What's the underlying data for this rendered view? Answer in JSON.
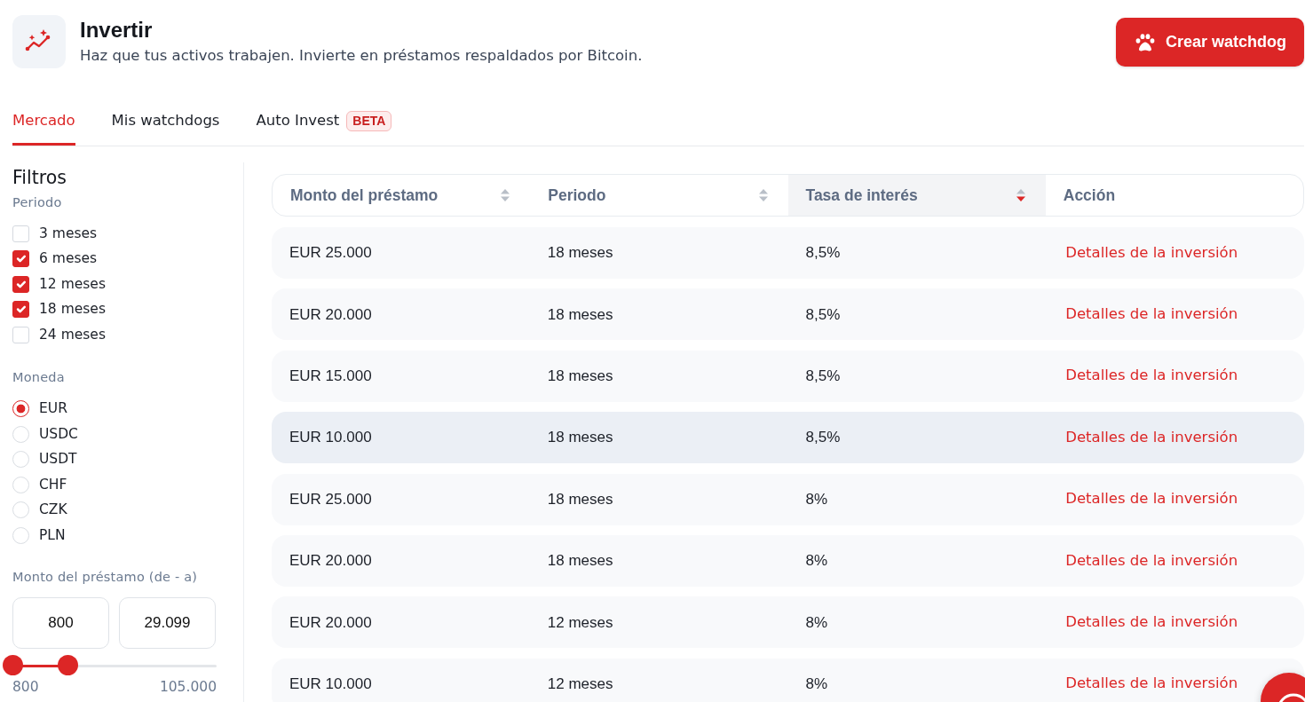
{
  "header": {
    "title": "Invertir",
    "subtitle": "Haz que tus activos trabajen. Invierte en préstamos respaldados por Bitcoin.",
    "action_button": "Crear watchdog"
  },
  "tabs": [
    {
      "label": "Mercado",
      "selected": true
    },
    {
      "label": "Mis watchdogs",
      "selected": false
    },
    {
      "label": "Auto Invest",
      "selected": false,
      "badge": "BETA"
    }
  ],
  "filters": {
    "title": "Filtros",
    "period": {
      "label": "Periodo",
      "options": [
        {
          "label": "3 meses",
          "checked": false
        },
        {
          "label": "6 meses",
          "checked": true
        },
        {
          "label": "12 meses",
          "checked": true
        },
        {
          "label": "18 meses",
          "checked": true
        },
        {
          "label": "24 meses",
          "checked": false
        }
      ]
    },
    "currency": {
      "label": "Moneda",
      "options": [
        {
          "label": "EUR",
          "selected": true
        },
        {
          "label": "USDC",
          "selected": false
        },
        {
          "label": "USDT",
          "selected": false
        },
        {
          "label": "CHF",
          "selected": false
        },
        {
          "label": "CZK",
          "selected": false
        },
        {
          "label": "PLN",
          "selected": false
        }
      ]
    },
    "amount": {
      "label": "Monto del préstamo (de - a)",
      "from_value": "800",
      "to_value": "29.099",
      "thumbs": [
        {
          "level": 0
        },
        {
          "level": 0.27
        }
      ],
      "min_label": "800",
      "max_label": "105.000"
    }
  },
  "table": {
    "columns": [
      {
        "label": "Monto del préstamo",
        "sortable": true,
        "sorted": false
      },
      {
        "label": "Periodo",
        "sortable": true,
        "sorted": false
      },
      {
        "label": "Tasa de interés",
        "sortable": true,
        "sorted": true
      },
      {
        "label": "Acción",
        "sortable": false,
        "sorted": false
      }
    ],
    "rows": [
      {
        "cells": [
          "EUR 25.000",
          "18 meses",
          "8,5%"
        ],
        "action": "Detalles de la inversión",
        "highlighted": false
      },
      {
        "cells": [
          "EUR 20.000",
          "18 meses",
          "8,5%"
        ],
        "action": "Detalles de la inversión",
        "highlighted": false
      },
      {
        "cells": [
          "EUR 15.000",
          "18 meses",
          "8,5%"
        ],
        "action": "Detalles de la inversión",
        "highlighted": false
      },
      {
        "cells": [
          "EUR 10.000",
          "18 meses",
          "8,5%"
        ],
        "action": "Detalles de la inversión",
        "highlighted": true
      },
      {
        "cells": [
          "EUR 25.000",
          "18 meses",
          "8%"
        ],
        "action": "Detalles de la inversión",
        "highlighted": false
      },
      {
        "cells": [
          "EUR 20.000",
          "18 meses",
          "8%"
        ],
        "action": "Detalles de la inversión",
        "highlighted": false
      },
      {
        "cells": [
          "EUR 20.000",
          "12 meses",
          "8%"
        ],
        "action": "Detalles de la inversión",
        "highlighted": false
      },
      {
        "cells": [
          "EUR 10.000",
          "12 meses",
          "8%"
        ],
        "action": "Detalles de la inversión",
        "highlighted": false
      }
    ]
  }
}
